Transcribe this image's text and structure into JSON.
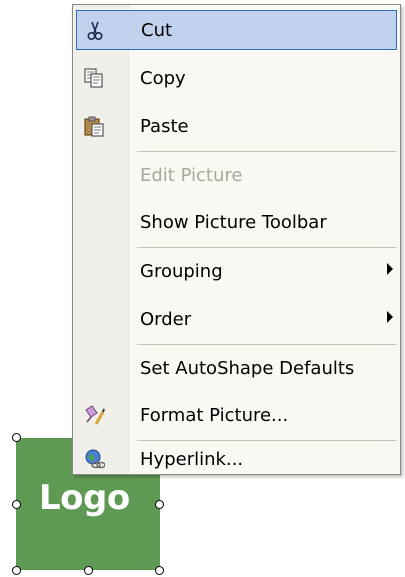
{
  "logo": {
    "text": "Logo",
    "bg_color": "#5e9a53"
  },
  "menu": {
    "highlight_color": "#c1d2ee",
    "items": [
      {
        "label": "Cut",
        "icon": "scissors-icon",
        "selected": true,
        "enabled": true
      },
      {
        "label": "Copy",
        "icon": "copy-icon",
        "enabled": true
      },
      {
        "label": "Paste",
        "icon": "paste-icon",
        "enabled": true
      },
      {
        "label": "Edit Picture",
        "enabled": false
      },
      {
        "label": "Show Picture Toolbar",
        "enabled": true
      },
      {
        "label": "Grouping",
        "submenu": true,
        "enabled": true
      },
      {
        "label": "Order",
        "submenu": true,
        "enabled": true
      },
      {
        "label": "Set AutoShape Defaults",
        "enabled": true
      },
      {
        "label": "Format Picture...",
        "icon": "format-picture-icon",
        "enabled": true
      },
      {
        "label": "Hyperlink...",
        "icon": "hyperlink-icon",
        "enabled": true
      }
    ]
  }
}
